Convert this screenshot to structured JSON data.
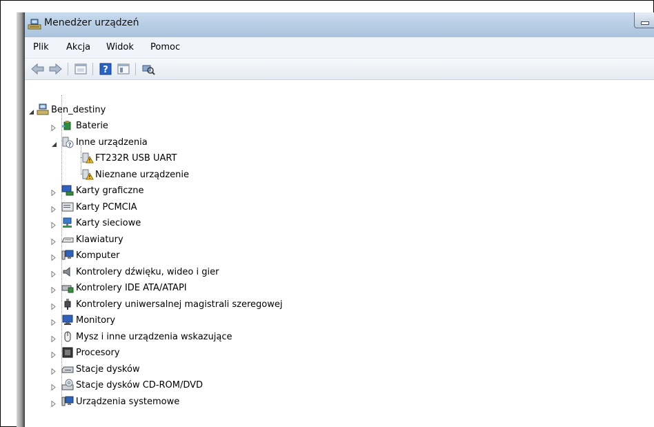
{
  "window": {
    "title": "Menedżer urządzeń"
  },
  "menu": [
    {
      "label": "Plik"
    },
    {
      "label": "Akcja"
    },
    {
      "label": "Widok"
    },
    {
      "label": "Pomoc"
    }
  ],
  "toolbar": {
    "buttons": [
      "back-icon",
      "forward-icon",
      "properties-icon",
      "help-icon",
      "console-tree-icon",
      "scan-hardware-icon"
    ]
  },
  "tree": {
    "root": {
      "label": "Ben_destiny",
      "icon": "computer-icon",
      "expanded": true
    },
    "categories": [
      {
        "label": "Baterie",
        "icon": "battery-icon",
        "expanded": false
      },
      {
        "label": "Inne urządzenia",
        "icon": "unknown-device-icon",
        "expanded": true,
        "children": [
          {
            "label": "FT232R USB UART",
            "icon": "warning-device-icon"
          },
          {
            "label": "Nieznane urządzenie",
            "icon": "warning-device-icon"
          }
        ]
      },
      {
        "label": "Karty graficzne",
        "icon": "display-adapter-icon",
        "expanded": false
      },
      {
        "label": "Karty PCMCIA",
        "icon": "pcmcia-icon",
        "expanded": false
      },
      {
        "label": "Karty sieciowe",
        "icon": "network-adapter-icon",
        "expanded": false
      },
      {
        "label": "Klawiatury",
        "icon": "keyboard-icon",
        "expanded": false
      },
      {
        "label": "Komputer",
        "icon": "computer-monitor-icon",
        "expanded": false
      },
      {
        "label": "Kontrolery dźwięku, wideo i gier",
        "icon": "speaker-icon",
        "expanded": false
      },
      {
        "label": "Kontrolery IDE ATA/ATAPI",
        "icon": "ide-controller-icon",
        "expanded": false
      },
      {
        "label": "Kontrolery uniwersalnej magistrali szeregowej",
        "icon": "usb-icon",
        "expanded": false
      },
      {
        "label": "Monitory",
        "icon": "monitor-icon",
        "expanded": false
      },
      {
        "label": "Mysz i inne urządzenia wskazujące",
        "icon": "mouse-icon",
        "expanded": false
      },
      {
        "label": "Procesory",
        "icon": "processor-icon",
        "expanded": false
      },
      {
        "label": "Stacje dysków",
        "icon": "floppy-drive-icon",
        "expanded": false
      },
      {
        "label": "Stacje dysków CD-ROM/DVD",
        "icon": "cdrom-drive-icon",
        "expanded": false
      },
      {
        "label": "Urządzenia systemowe",
        "icon": "system-devices-icon",
        "expanded": false
      }
    ]
  }
}
